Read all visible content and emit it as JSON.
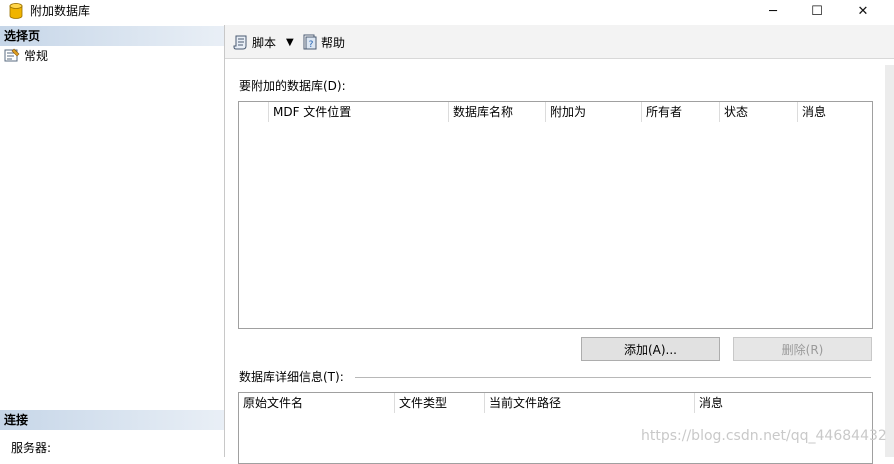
{
  "window": {
    "title": "附加数据库",
    "min": "─",
    "max": "☐",
    "close": "✕"
  },
  "left": {
    "select_page_header": "选择页",
    "items": [
      {
        "label": "常规"
      }
    ],
    "connect_header": "连接",
    "server_label": "服务器:"
  },
  "toolbar": {
    "script_label": "脚本",
    "caret": "▼",
    "help_label": "帮助"
  },
  "attach": {
    "label": "要附加的数据库(D):",
    "columns": [
      "MDF 文件位置",
      "数据库名称",
      "附加为",
      "所有者",
      "状态",
      "消息"
    ],
    "add_button": "添加(A)...",
    "remove_button": "删除(R)"
  },
  "details": {
    "label": "数据库详细信息(T):",
    "columns": [
      "原始文件名",
      "文件类型",
      "当前文件路径",
      "消息"
    ]
  },
  "watermark": "https://blog.csdn.net/qq_44684432",
  "colors": {
    "section_header": "#c6d6e8",
    "toolbar": "#f3f3f3",
    "db_icon": "#f0b400"
  }
}
